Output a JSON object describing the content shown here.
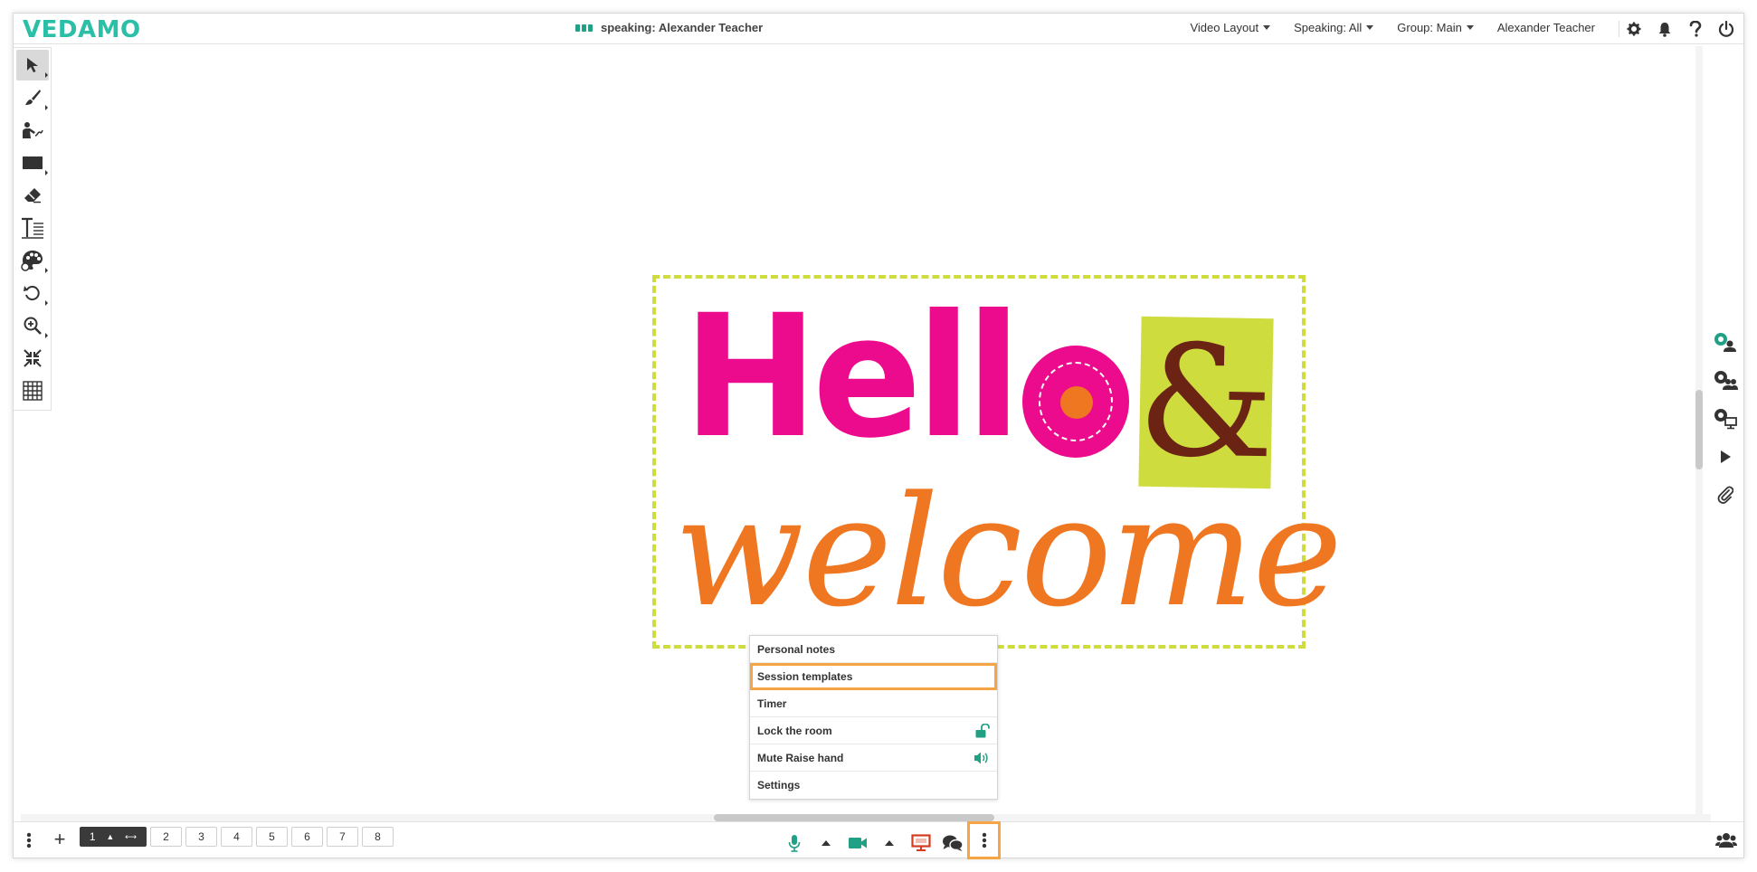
{
  "app": {
    "logo": "VEDAMO"
  },
  "header": {
    "speaking_status": "speaking: Alexander Teacher",
    "menus": [
      {
        "label": "Video Layout"
      },
      {
        "label": "Speaking: All"
      },
      {
        "label": "Group: Main"
      }
    ],
    "user_name": "Alexander Teacher",
    "icons": [
      "gear-icon",
      "bell-icon",
      "help-icon",
      "power-icon"
    ]
  },
  "tools": [
    "select-tool",
    "pen-tool",
    "pointer-tool",
    "shape-tool",
    "eraser-tool",
    "text-tool",
    "color-tool",
    "undo-tool",
    "zoom-tool",
    "fit-tool",
    "grid-tool"
  ],
  "canvas": {
    "image_text": {
      "hello": "Hell",
      "ampersand": "&",
      "welcome": "welcome"
    },
    "colors": {
      "pink": "#ec0b8c",
      "lime": "#cfdc3e",
      "orange": "#f07722",
      "brown": "#6b2414"
    }
  },
  "more_menu": {
    "items": [
      {
        "label": "Personal notes"
      },
      {
        "label": "Session templates",
        "highlighted": true
      },
      {
        "label": "Timer"
      },
      {
        "label": "Lock the room",
        "icon": "unlock-icon"
      },
      {
        "label": "Mute Raise hand",
        "icon": "speaker-icon"
      },
      {
        "label": "Settings"
      }
    ]
  },
  "bottom": {
    "pages": [
      "1",
      "2",
      "3",
      "4",
      "5",
      "6",
      "7",
      "8"
    ],
    "active_page": "1"
  },
  "accent_color": "#2bbfa7",
  "focus_outline_color": "#f5a544"
}
